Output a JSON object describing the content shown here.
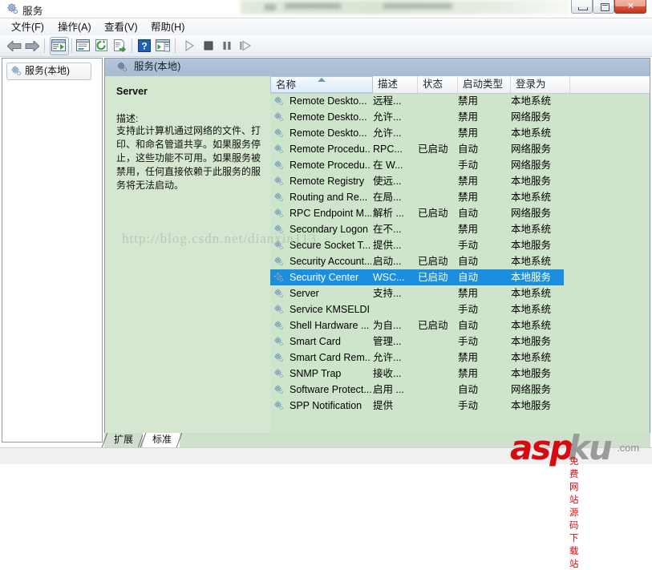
{
  "window": {
    "title": "服务",
    "icon": "services-gear-icon",
    "controls": {
      "minimize": "最小化",
      "maximize": "还原",
      "close": "关闭",
      "close_glyph": "✕"
    }
  },
  "menu": {
    "items": [
      {
        "label": "文件(F)",
        "name": "menu-file"
      },
      {
        "label": "操作(A)",
        "name": "menu-action"
      },
      {
        "label": "查看(V)",
        "name": "menu-view"
      },
      {
        "label": "帮助(H)",
        "name": "menu-help"
      }
    ]
  },
  "toolbar": {
    "buttons": [
      {
        "name": "back-arrow-icon",
        "tooltip": "后退"
      },
      {
        "name": "forward-arrow-icon",
        "tooltip": "前进"
      },
      {
        "name": "show-tree-icon",
        "tooltip": "显示/隐藏控制台树"
      },
      {
        "name": "properties-icon",
        "tooltip": "属性"
      },
      {
        "name": "refresh-icon",
        "tooltip": "刷新"
      },
      {
        "name": "export-list-icon",
        "tooltip": "导出列表"
      },
      {
        "name": "help-icon",
        "tooltip": "帮助"
      },
      {
        "name": "show-action-pane-icon",
        "tooltip": "显示/隐藏操作窗格"
      },
      {
        "name": "start-service-icon",
        "tooltip": "启动服务"
      },
      {
        "name": "stop-service-icon",
        "tooltip": "停止服务"
      },
      {
        "name": "pause-service-icon",
        "tooltip": "暂停服务"
      },
      {
        "name": "restart-service-icon",
        "tooltip": "重启服务"
      }
    ]
  },
  "tree": {
    "root": {
      "label": "服务(本地)",
      "icon": "services-gear-icon"
    }
  },
  "pane_header": {
    "title": "服务(本地)",
    "icon": "services-gear-icon"
  },
  "details": {
    "service_name": "Server",
    "description_label": "描述:",
    "description_text": "支持此计算机通过网络的文件、打印、和命名管道共享。如果服务停止，这些功能不可用。如果服务被禁用，任何直接依赖于此服务的服务将无法启动。"
  },
  "list": {
    "columns": [
      {
        "label": "名称",
        "name": "column-name",
        "sorted": true
      },
      {
        "label": "描述",
        "name": "column-description",
        "sorted": false
      },
      {
        "label": "状态",
        "name": "column-status",
        "sorted": false
      },
      {
        "label": "启动类型",
        "name": "column-startup-type",
        "sorted": false
      },
      {
        "label": "登录为",
        "name": "column-log-on-as",
        "sorted": false
      }
    ],
    "selected_index": 11,
    "rows": [
      {
        "name": "Remote Deskto...",
        "desc": "远程...",
        "state": "",
        "start": "禁用",
        "logon": "本地系统"
      },
      {
        "name": "Remote Deskto...",
        "desc": "允许...",
        "state": "",
        "start": "禁用",
        "logon": "网络服务"
      },
      {
        "name": "Remote Deskto...",
        "desc": "允许...",
        "state": "",
        "start": "禁用",
        "logon": "本地系统"
      },
      {
        "name": "Remote Procedu...",
        "desc": "RPC...",
        "state": "已启动",
        "start": "自动",
        "logon": "网络服务"
      },
      {
        "name": "Remote Procedu...",
        "desc": "在 W...",
        "state": "",
        "start": "手动",
        "logon": "网络服务"
      },
      {
        "name": "Remote Registry",
        "desc": "使远...",
        "state": "",
        "start": "禁用",
        "logon": "本地服务"
      },
      {
        "name": "Routing and Re...",
        "desc": "在局...",
        "state": "",
        "start": "禁用",
        "logon": "本地系统"
      },
      {
        "name": "RPC Endpoint M...",
        "desc": "解析 ...",
        "state": "已启动",
        "start": "自动",
        "logon": "网络服务"
      },
      {
        "name": "Secondary Logon",
        "desc": "在不...",
        "state": "",
        "start": "禁用",
        "logon": "本地系统"
      },
      {
        "name": "Secure Socket T...",
        "desc": "提供...",
        "state": "",
        "start": "手动",
        "logon": "本地服务"
      },
      {
        "name": "Security Account...",
        "desc": "启动...",
        "state": "已启动",
        "start": "自动",
        "logon": "本地系统"
      },
      {
        "name": "Security Center",
        "desc": "WSC...",
        "state": "已启动",
        "start": "自动",
        "logon": "本地服务"
      },
      {
        "name": "Server",
        "desc": "支持...",
        "state": "",
        "start": "禁用",
        "logon": "本地系统"
      },
      {
        "name": "Service KMSELDI",
        "desc": "",
        "state": "",
        "start": "手动",
        "logon": "本地系统"
      },
      {
        "name": "Shell Hardware ...",
        "desc": "为自...",
        "state": "已启动",
        "start": "自动",
        "logon": "本地系统"
      },
      {
        "name": "Smart Card",
        "desc": "管理...",
        "state": "",
        "start": "手动",
        "logon": "本地服务"
      },
      {
        "name": "Smart Card Rem...",
        "desc": "允许...",
        "state": "",
        "start": "禁用",
        "logon": "本地系统"
      },
      {
        "name": "SNMP Trap",
        "desc": "接收...",
        "state": "",
        "start": "禁用",
        "logon": "本地服务"
      },
      {
        "name": "Software Protect...",
        "desc": "启用 ...",
        "state": "",
        "start": "自动",
        "logon": "网络服务"
      },
      {
        "name": "SPP Notification",
        "desc": "提供",
        "state": "",
        "start": "手动",
        "logon": "本地服务"
      }
    ]
  },
  "tabs": [
    {
      "label": "扩展",
      "name": "tab-extended",
      "active": true
    },
    {
      "label": "标准",
      "name": "tab-standard",
      "active": false
    }
  ],
  "watermarks": {
    "csdn": "http://blog.csdn.net/dianxin113",
    "aspku_a": "asp",
    "aspku_b": "ku",
    "aspku_com": ".com",
    "aspku_sub": "免费网站源码下载站"
  },
  "colors": {
    "selection": "#1a8fe0",
    "pane_bg": "#cfe5cb",
    "header_bg": "#a7bbd2",
    "close_btn": "#c6341d",
    "watermark_red": "#d60a10"
  }
}
